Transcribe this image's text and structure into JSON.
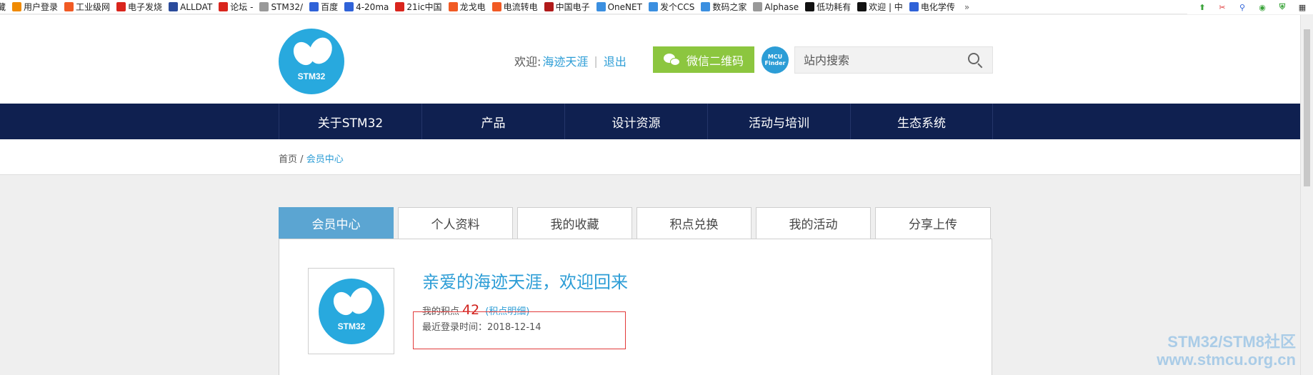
{
  "bookmarks": {
    "items": [
      {
        "label": "藏",
        "icon": "chevron-icon",
        "color": "#777777"
      },
      {
        "label": "用户登录",
        "icon": "bookmark-icon",
        "color": "#f08a00"
      },
      {
        "label": "工业级网",
        "icon": "taobao-icon",
        "color": "#f15a24"
      },
      {
        "label": "电子发烧",
        "icon": "site-icon",
        "color": "#d9251d"
      },
      {
        "label": "ALLDAT",
        "icon": "datasheet-icon",
        "color": "#2b4b9b"
      },
      {
        "label": "论坛 -",
        "icon": "forum-icon",
        "color": "#d9251d"
      },
      {
        "label": "STM32/",
        "icon": "page-icon",
        "color": "#999999"
      },
      {
        "label": "百度",
        "icon": "baidu-icon",
        "color": "#2f62d8"
      },
      {
        "label": "4-20ma",
        "icon": "baidu-icon",
        "color": "#2f62d8"
      },
      {
        "label": "21ic中国",
        "icon": "site-icon",
        "color": "#d9251d"
      },
      {
        "label": "龙戈电",
        "icon": "taobao-icon",
        "color": "#f15a24"
      },
      {
        "label": "电流转电",
        "icon": "taobao-icon",
        "color": "#f15a24"
      },
      {
        "label": "中国电子",
        "icon": "site-icon",
        "color": "#b01a1a"
      },
      {
        "label": "OneNET",
        "icon": "cloud-icon",
        "color": "#3b8fe0"
      },
      {
        "label": "发个CCS",
        "icon": "home-icon",
        "color": "#3b8fe0"
      },
      {
        "label": "数码之家",
        "icon": "home-icon",
        "color": "#3b8fe0"
      },
      {
        "label": "Alphase",
        "icon": "page-icon",
        "color": "#999999"
      },
      {
        "label": "低功耗有",
        "icon": "play-icon",
        "color": "#111111"
      },
      {
        "label": "欢迎 | 中",
        "icon": "play-icon",
        "color": "#111111"
      },
      {
        "label": "电化学传",
        "icon": "baidu-icon",
        "color": "#2f62d8"
      }
    ],
    "more": "»"
  },
  "header": {
    "logo_text": "STM32",
    "welcome_label": "欢迎:",
    "username": "海迹天涯",
    "separator": "|",
    "logout": "退出",
    "wechat_button": "微信二维码",
    "mcu_finder": "MCU Finder",
    "search_placeholder": "站内搜索"
  },
  "nav": [
    "关于STM32",
    "产品",
    "设计资源",
    "活动与培训",
    "生态系统"
  ],
  "breadcrumb": {
    "home": "首页",
    "divider": "/",
    "current": "会员中心"
  },
  "tabs": [
    {
      "label": "会员中心",
      "active": true
    },
    {
      "label": "个人资料",
      "active": false
    },
    {
      "label": "我的收藏",
      "active": false
    },
    {
      "label": "积点兑换",
      "active": false
    },
    {
      "label": "我的活动",
      "active": false
    },
    {
      "label": "分享上传",
      "active": false
    }
  ],
  "profile": {
    "avatar_text": "STM32",
    "greeting": "亲爱的海迹天涯，欢迎回来",
    "points_label": "我的积点",
    "points_value": "42",
    "points_detail": "(积点明细)",
    "last_login": "最近登录时间：2018-12-14"
  },
  "watermark": {
    "line1": "STM32/STM8社区",
    "line2": "www.stmcu.org.cn"
  },
  "colors": {
    "nav_bg": "#0f2050",
    "accent": "#2c9dd6",
    "wechat": "#8cc63f",
    "active_tab": "#5ba5d2",
    "points": "#d0201b",
    "highlight": "#e23a3a"
  }
}
